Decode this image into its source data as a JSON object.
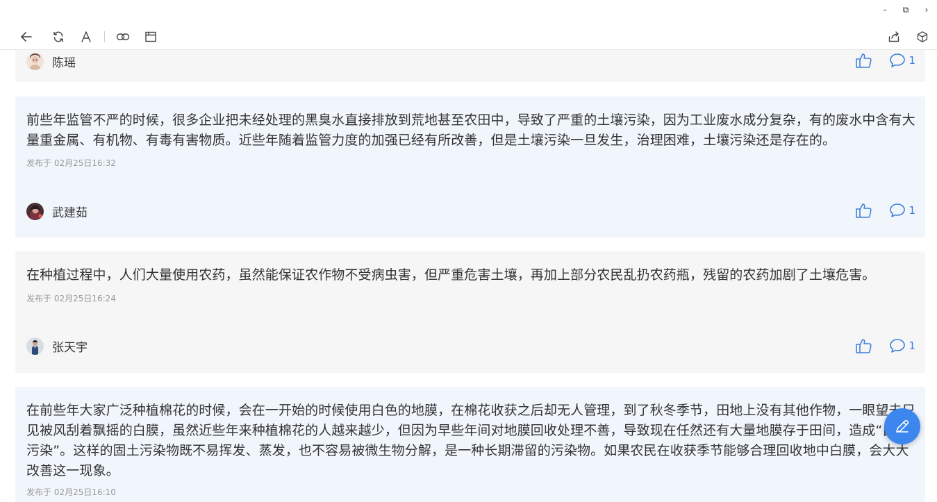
{
  "window_controls": {
    "minimize": "–",
    "restore": "⧉",
    "more": "›"
  },
  "toolbar": {
    "icons": [
      "back-icon",
      "refresh-icon",
      "font-icon",
      "link-icon",
      "window-icon",
      "share-icon",
      "cube-icon"
    ]
  },
  "posts": [
    {
      "author": "陈瑶",
      "comment_count": "1"
    },
    {
      "text": "前些年监管不严的时候，很多企业把未经处理的黑臭水直接排放到荒地甚至农田中，导致了严重的土壤污染，因为工业废水成分复杂，有的废水中含有大量重金属、有机物、有毒有害物质。近些年随着监管力度的加强已经有所改善，但是土壤污染一旦发生，治理困难，土壤污染还是存在的。",
      "date": "发布于 02月25日16:32",
      "author": "武建茹",
      "comment_count": "1"
    },
    {
      "text": "在种植过程中，人们大量使用农药，虽然能保证农作物不受病虫害，但严重危害土壤，再加上部分农民乱扔农药瓶，残留的农药加剧了土壤危害。",
      "date": "发布于 02月25日16:24",
      "author": "张天宇",
      "comment_count": "1"
    },
    {
      "text": "在前些年大家广泛种植棉花的时候，会在一开始的时候使用白色的地膜，在棉花收获之后却无人管理，到了秋冬季节，田地上没有其他作物，一眼望去只见被风刮着飘摇的白膜，虽然近些年来种植棉花的人越来越少，但因为早些年间对地膜回收处理不善，导致现在任然还有大量地膜存于田间，造成“白色污染”。这样的固土污染物既不易挥发、蒸发，也不容易被微生物分解，是一种长期滞留的污染物。如果农民在收获季节能够合理回收地中白膜，会大大改善这一现象。",
      "date": "发布于 02月25日16:10"
    }
  ],
  "colors": {
    "accent": "#3d7fdc",
    "card_blue": "#f1f6fd",
    "card_gray": "#f6f6f6",
    "fab": "#3d86ee"
  }
}
